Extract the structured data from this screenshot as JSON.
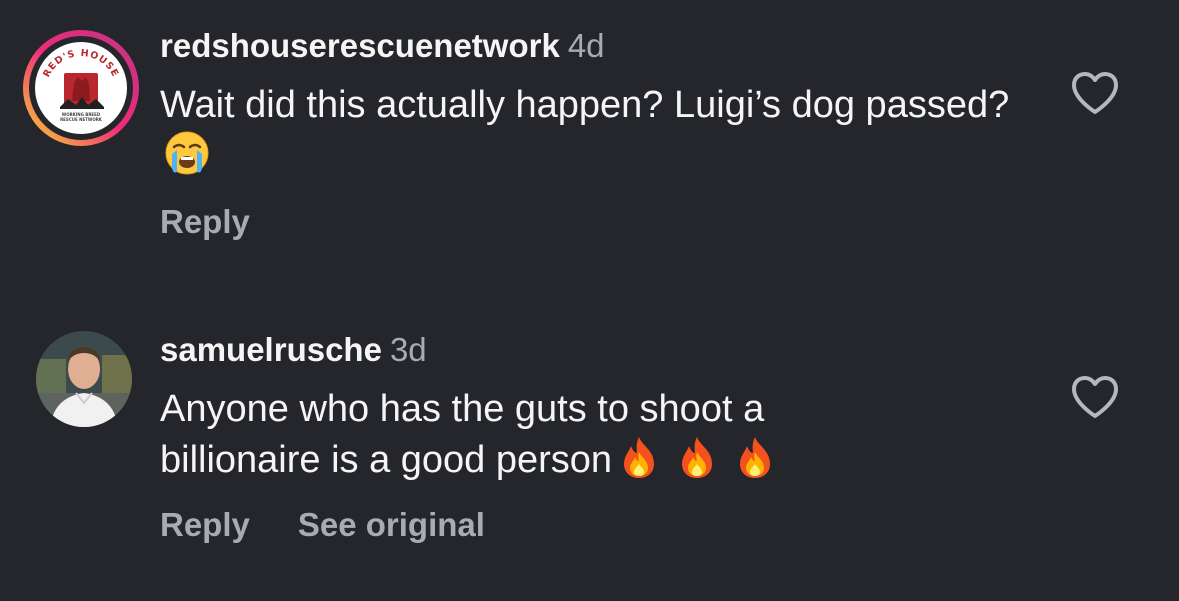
{
  "comments": [
    {
      "username": "redshouserescuenetwork",
      "time": "4d",
      "text": "Wait did this actually happen? Luigi’s dog passed?",
      "emojis": [
        "loudly-crying-face-emoji"
      ],
      "reply_label": "Reply",
      "avatar_logo_text": "RED'S HOUSE",
      "avatar_logo_subtext": "WORKING BREED RESCUE NETWORK",
      "avatar_ring_colors": [
        "#f9ce34",
        "#ee2a7b",
        "#6228d7"
      ],
      "heart_icon": "heart-outline-icon"
    },
    {
      "username": "samuelrusche",
      "time": "3d",
      "text": "Anyone who has the guts to shoot a billionaire is a good person",
      "emojis": [
        "fire-emoji",
        "fire-emoji",
        "fire-emoji"
      ],
      "reply_label": "Reply",
      "see_original_label": "See original",
      "heart_icon": "heart-outline-icon"
    }
  ],
  "colors": {
    "background": "#25262b",
    "primary_text": "#f5f5f5",
    "secondary_text": "#a8abb2",
    "brand_red": "#b8282c"
  }
}
